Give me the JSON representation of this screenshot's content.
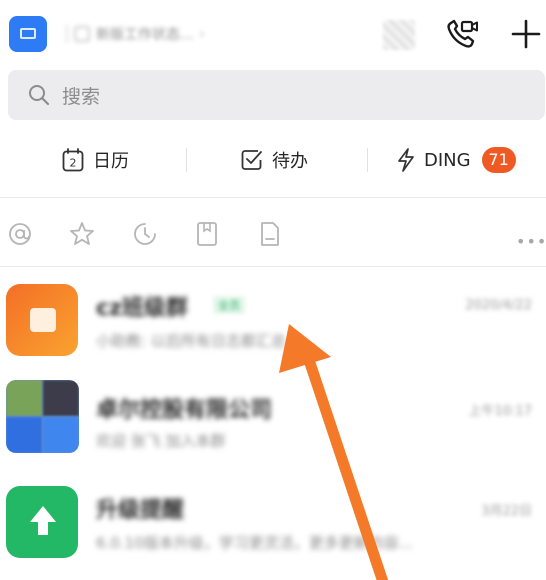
{
  "header": {
    "org_name": "新版工作状态...",
    "org_chevron": "›"
  },
  "search": {
    "placeholder": "搜索"
  },
  "quick": {
    "calendar_label": "日历",
    "calendar_day": "2",
    "todo_label": "待办",
    "ding_label": "DING",
    "ding_count": "71"
  },
  "filters": {
    "more": "•••"
  },
  "conversations": [
    {
      "title": "cz班级群",
      "tag": "全员",
      "time": "2020/4/22",
      "message": "小助教: 以后所有日志都汇总",
      "tag_color": "#2fb36b"
    },
    {
      "title": "卓尔控股有限公司",
      "tag": "",
      "time": "上午10:17",
      "message": "欢迎 张飞 加入本群"
    },
    {
      "title": "升级提醒",
      "tag": "",
      "time": "3月22日",
      "message": "6.0.10版本升级，学习更灵活，更多更新内容..."
    }
  ],
  "colors": {
    "accent": "#2d7cf6",
    "ding_badge": "#ef5a24",
    "arrow": "#f47a2a",
    "avatar_orange": "#f46f26",
    "avatar_green": "#22b866"
  }
}
